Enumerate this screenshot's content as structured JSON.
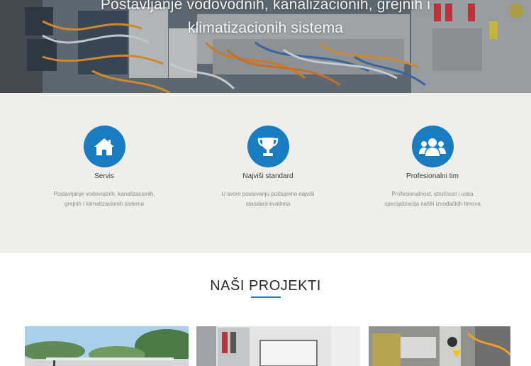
{
  "hero": {
    "title_line1": "Postavljanje vodovodnih, kanalizacionih, grejnih i",
    "title_line2": "klimatizacionih sistema"
  },
  "features": [
    {
      "icon": "home-icon",
      "title": "Servis",
      "desc_line1": "Postavljanje vodovodnih, kanalizacionih,",
      "desc_line2": "grejnih i klimatizacionih sistema"
    },
    {
      "icon": "trophy-icon",
      "title": "Najviši standard",
      "desc_line1": "U svom poslovanju poštujemo najviši",
      "desc_line2": "standard kvaliteta"
    },
    {
      "icon": "users-icon",
      "title": "Profesionalni tim",
      "desc_line1": "Profesionalnost, stručnost i uska",
      "desc_line2": "specijalizacija naših izvođačkih timova"
    }
  ],
  "projects": {
    "heading_part1": "NAŠI ",
    "heading_part2": "PROJEKTI"
  },
  "colors": {
    "accent": "#1a7cc0",
    "feature_bg": "#efeeea"
  }
}
